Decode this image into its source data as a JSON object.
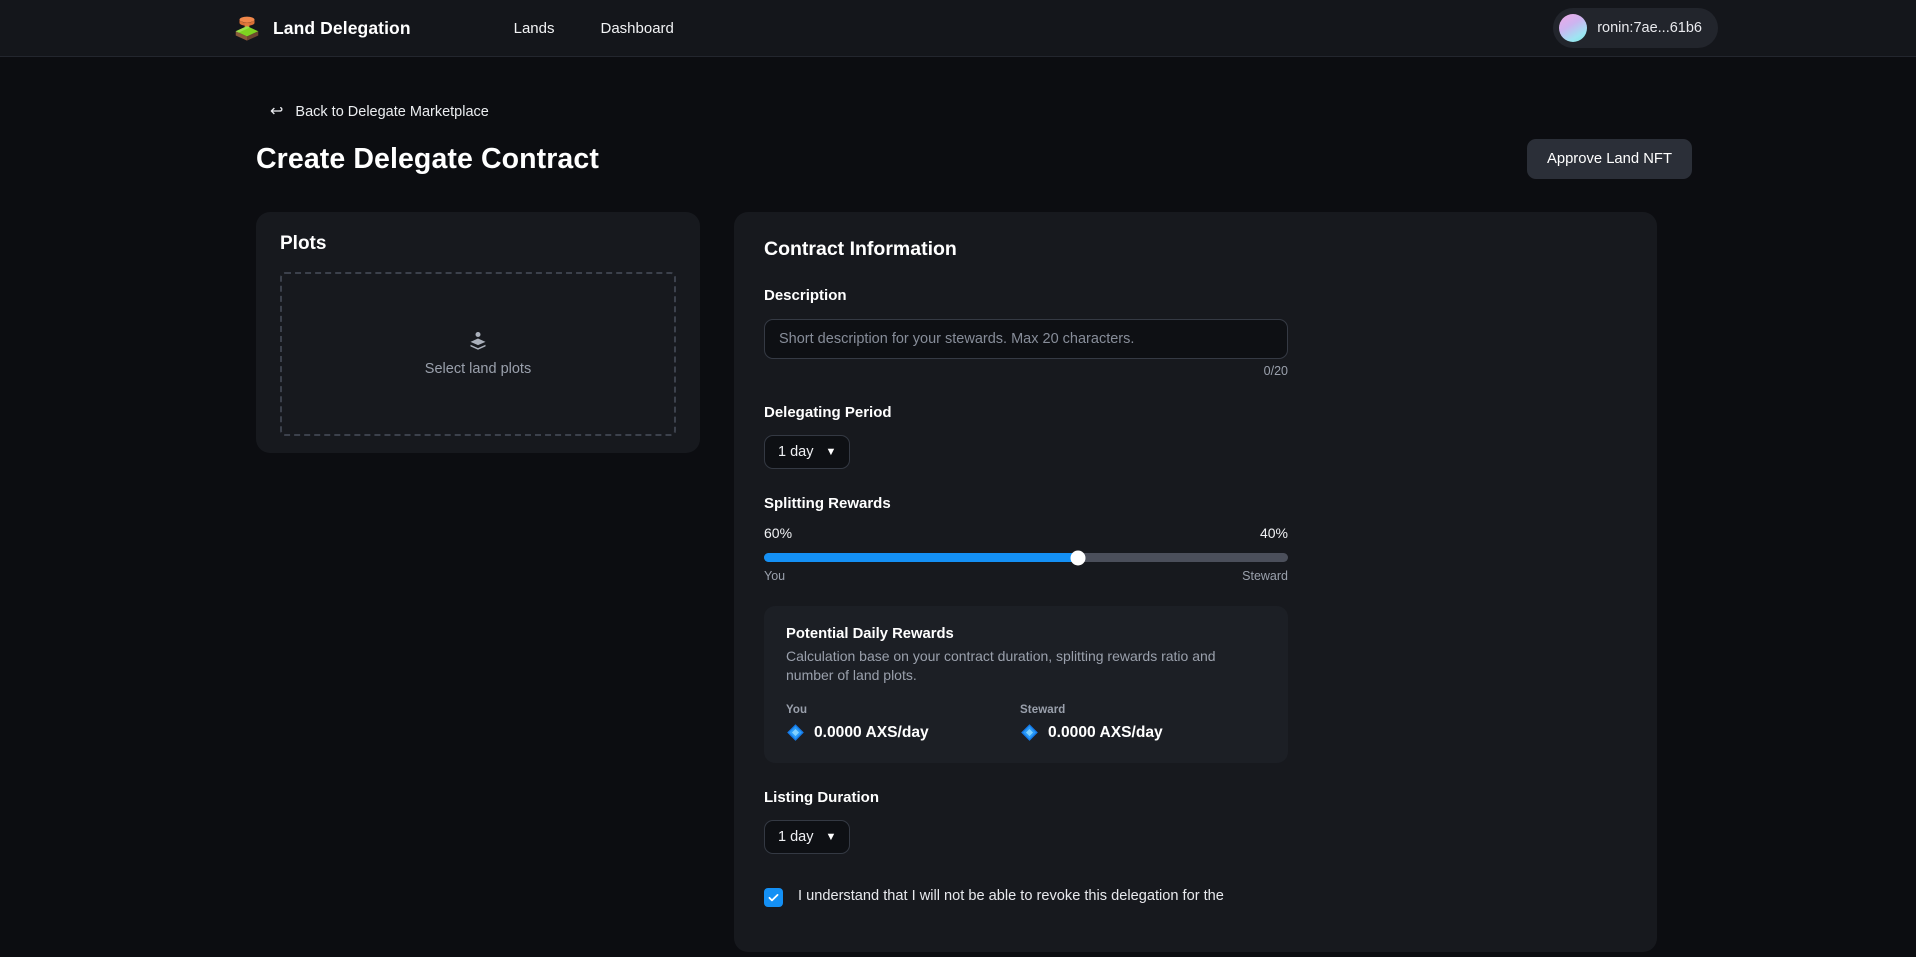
{
  "header": {
    "logo_icon": "land-block-icon",
    "brand": "Land Delegation",
    "nav": [
      {
        "label": "Lands",
        "name": "nav-lands"
      },
      {
        "label": "Dashboard",
        "name": "nav-dashboard"
      }
    ],
    "wallet": {
      "address": "ronin:7ae...61b6",
      "avatar_icon": "wallet-avatar-gradient"
    }
  },
  "breadcrumb": {
    "back_icon": "undo-arrow-icon",
    "back_label": "Back to Delegate Marketplace"
  },
  "page": {
    "title": "Create Delegate Contract",
    "approve_button": "Approve Land NFT"
  },
  "plots": {
    "title": "Plots",
    "dropzone_icon": "layers-icon",
    "dropzone_label": "Select land plots"
  },
  "contract": {
    "title": "Contract Information",
    "description": {
      "label": "Description",
      "value": "",
      "placeholder": "Short description for your stewards. Max 20 characters.",
      "counter": "0/20"
    },
    "delegating_period": {
      "label": "Delegating Period",
      "value": "1 day",
      "caret_icon": "chevron-down-icon",
      "options": [
        "1 day"
      ]
    },
    "splitting_rewards": {
      "label": "Splitting Rewards",
      "you_percent": "60%",
      "steward_percent": "40%",
      "you_caption": "You",
      "steward_caption": "Steward",
      "slider_value": 60,
      "fill_color": "#1490f5",
      "track_color": "#4b4f5b",
      "thumb_color": "#ffffff"
    },
    "potential_rewards": {
      "title": "Potential Daily Rewards",
      "description": "Calculation base on your contract duration, splitting rewards ratio and number of land plots.",
      "entries": [
        {
          "label": "You",
          "icon": "axs-token-icon",
          "value": "0.0000 AXS/day"
        },
        {
          "label": "Steward",
          "icon": "axs-token-icon",
          "value": "0.0000 AXS/day"
        }
      ]
    },
    "listing_duration": {
      "label": "Listing Duration",
      "value": "1 day",
      "caret_icon": "chevron-down-icon",
      "options": [
        "1 day"
      ]
    },
    "agreement": {
      "checked": true,
      "check_icon": "checkmark-icon",
      "text": "I understand that I will not be able to revoke this delegation for the"
    }
  },
  "colors": {
    "page_bg": "#0c0d11",
    "header_bg": "#14161b",
    "card_bg": "#17191e",
    "accent": "#1490f5",
    "muted_text": "#9aa0ac"
  }
}
